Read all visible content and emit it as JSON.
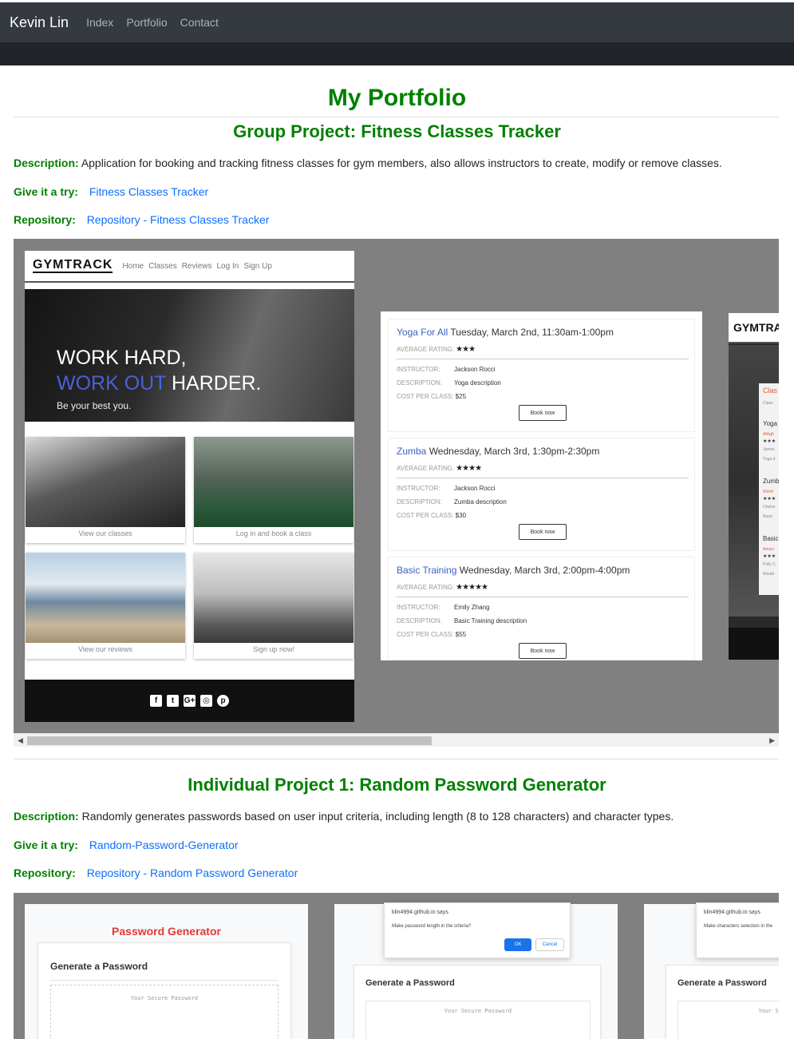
{
  "nav": {
    "brand": "Kevin Lin",
    "links": [
      "Index",
      "Portfolio",
      "Contact"
    ]
  },
  "page_title": "My Portfolio",
  "labels": {
    "description": "Description:",
    "try": "Give it a try:",
    "repository": "Repository:"
  },
  "projects": [
    {
      "title": "Group Project: Fitness Classes Tracker",
      "description": "Application for booking and tracking fitness classes for gym members, also allows instructors to create, modify or remove classes.",
      "try_link": "Fitness Classes Tracker",
      "repo_link": "Repository - Fitness Classes Tracker"
    },
    {
      "title": "Individual Project 1: Random Password Generator",
      "description": "Randomly generates passwords based on user input criteria, including length (8 to 128 characters) and character types.",
      "try_link": "Random-Password-Generator",
      "repo_link": "Repository - Random Password Generator"
    }
  ],
  "gymtrack": {
    "logo": "GYMTRACK",
    "logo_partial": "GYMTRA",
    "nav": [
      "Home",
      "Classes",
      "Reviews",
      "Log In",
      "Sign Up"
    ],
    "hero_line1": "WORK HARD,",
    "hero_line2_blue": "WORK OUT",
    "hero_line2_rest": " HARDER.",
    "hero_sub": "Be your best you.",
    "tiles": [
      "View our classes",
      "Log in and book a class",
      "View our reviews",
      "Sign up now!"
    ],
    "social_icons": [
      "facebook-icon",
      "twitter-icon",
      "google-plus-icon",
      "instagram-icon",
      "pinterest-icon"
    ],
    "partial_texts": [
      "Clas",
      "Class",
      "Yoga",
      "Allrigh",
      "James",
      "Yoga d",
      "Zumb",
      "Worth",
      "Chelse",
      "Basic",
      "Basic",
      "Amazi",
      "Polly C",
      "Would"
    ]
  },
  "classes": {
    "avg_label": "AVERAGE RATING:",
    "instructor_label": "INSTRUCTOR:",
    "description_label": "DESCRIPTION:",
    "cost_label": "COST PER CLASS:",
    "book_label": "Book now",
    "items": [
      {
        "name": "Yoga For All",
        "date": " Tuesday, March 2nd, 11:30am-1:00pm",
        "stars": "★★★",
        "instructor": "Jackson Rocci",
        "description": "Yoga description",
        "cost": "$25"
      },
      {
        "name": "Zumba",
        "date": " Wednesday, March 3rd, 1:30pm-2:30pm",
        "stars": "★★★★",
        "instructor": "Jackson Rocci",
        "description": "Zumba description",
        "cost": "$30"
      },
      {
        "name": "Basic Training",
        "date": " Wednesday, March 3rd, 2:00pm-4:00pm",
        "stars": "★★★★★",
        "instructor": "Emily Zhang",
        "description": "Basic Training description",
        "cost": "$55"
      }
    ]
  },
  "password": {
    "app_title": "Password Generator",
    "card_title": "Generate a Password",
    "placeholder": "Your Secure Password",
    "placeholder_partial": "Your Se",
    "alert_site": "klin4994.github.io says",
    "alert_msg1": "Make password length in the criteria?",
    "alert_msg2": "Make characters selection in the",
    "ok": "OK",
    "cancel": "Cancel"
  },
  "colors": {
    "heading_green": "#008000",
    "link_blue": "#0d6efd",
    "navbar": "#343a40",
    "gallery_bg": "#808080"
  }
}
